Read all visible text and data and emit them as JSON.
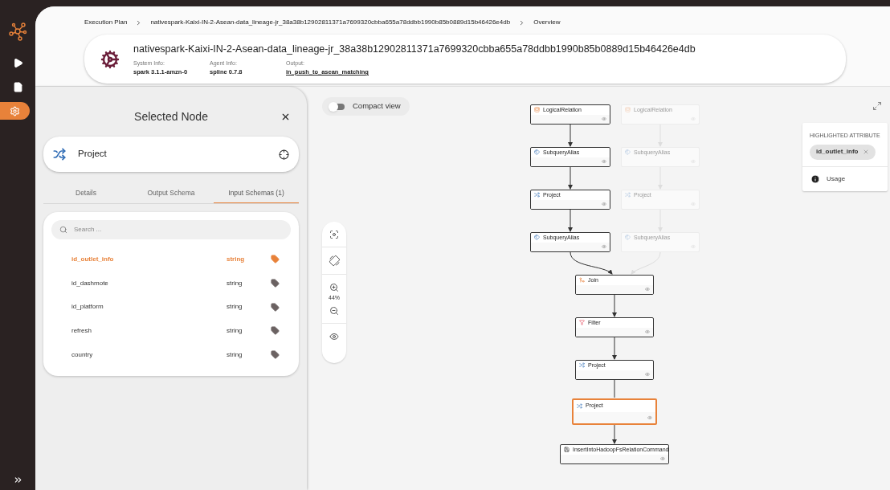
{
  "sidebar": {
    "items": [
      {
        "selected": false
      },
      {
        "selected": false
      },
      {
        "selected": true
      }
    ]
  },
  "breadcrumb": [
    {
      "label": "Execution Plan"
    },
    {
      "label": "nativespark-Kaixi-IN-2-Asean-data_lineage-jr_38a38b12902811371a7699320cbba655a78ddbb1990b85b0889d15b46426e4db"
    },
    {
      "label": "Overview"
    }
  ],
  "plan": {
    "title": "nativespark-Kaixi-IN-2-Asean-data_lineage-jr_38a38b12902811371a7699320cbba655a78ddbb1990b85b0889d15b46426e4db",
    "info": [
      {
        "label": "System Info:",
        "value": "spark 3.1.1-amzn-0",
        "kind": "text"
      },
      {
        "label": "Agent Info:",
        "value": "spline 0.7.8",
        "kind": "text"
      },
      {
        "label": "Output:",
        "value": "in_push_to_asean_matching",
        "kind": "link"
      }
    ]
  },
  "selected_node": {
    "title": "Selected Node",
    "node": "Project",
    "tabs": [
      {
        "label": "Details",
        "selected": false
      },
      {
        "label": "Output Schema",
        "selected": false
      },
      {
        "label": "Input Schemas (1)",
        "selected": true
      }
    ],
    "search": {
      "placeholder": "Search ..."
    },
    "attributes": [
      {
        "name": "id_outlet_info",
        "type": "string",
        "selected": true
      },
      {
        "name": "id_dashmote",
        "type": "string",
        "selected": false
      },
      {
        "name": "id_platform",
        "type": "string",
        "selected": false
      },
      {
        "name": "refresh",
        "type": "string",
        "selected": false
      },
      {
        "name": "country",
        "type": "string",
        "selected": false
      }
    ]
  },
  "compact_view": {
    "label": "Compact view",
    "on": false
  },
  "zoom": {
    "reading": "44%"
  },
  "graph": {
    "nodes": [
      {
        "label": "LogicalRelation",
        "kind": "relation",
        "faded": false,
        "selected": false
      },
      {
        "label": "LogicalRelation",
        "kind": "relation",
        "faded": true,
        "selected": false
      },
      {
        "label": "SubqueryAlias",
        "kind": "alias",
        "faded": false,
        "selected": false
      },
      {
        "label": "SubqueryAlias",
        "kind": "alias",
        "faded": true,
        "selected": false
      },
      {
        "label": "Project",
        "kind": "project",
        "faded": false,
        "selected": false
      },
      {
        "label": "Project",
        "kind": "project",
        "faded": true,
        "selected": false
      },
      {
        "label": "SubqueryAlias",
        "kind": "alias",
        "faded": false,
        "selected": false
      },
      {
        "label": "SubqueryAlias",
        "kind": "alias",
        "faded": true,
        "selected": false
      },
      {
        "label": "Join",
        "kind": "join",
        "faded": false,
        "selected": false
      },
      {
        "label": "Filter",
        "kind": "filter",
        "faded": false,
        "selected": false
      },
      {
        "label": "Project",
        "kind": "project",
        "faded": false,
        "selected": false
      },
      {
        "label": "Project",
        "kind": "project",
        "faded": false,
        "selected": true
      },
      {
        "label": "InsertIntoHadoopFsRelationCommand",
        "kind": "write",
        "faded": false,
        "selected": false
      }
    ]
  },
  "highlighted_attribute": {
    "heading": "HIGHLIGHTED ATTRIBUTE",
    "value": "id_outlet_info"
  },
  "usage": {
    "label": "Usage"
  }
}
